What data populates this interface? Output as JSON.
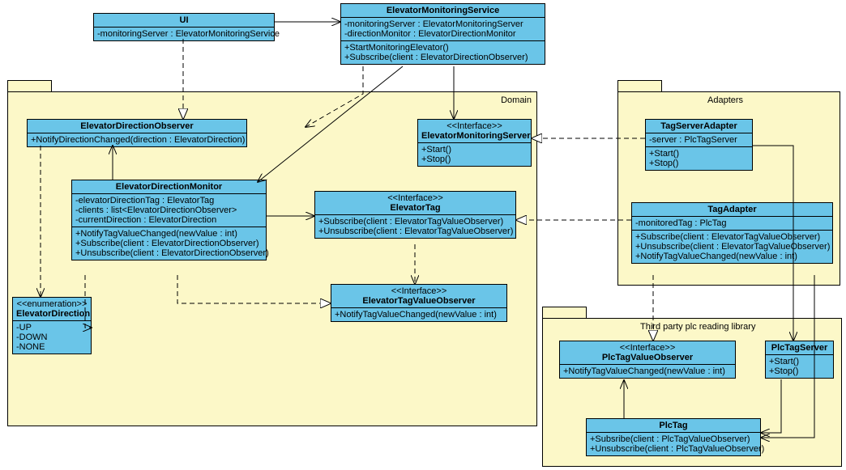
{
  "packages": {
    "domain": {
      "label": "Domain"
    },
    "adapters": {
      "label": "Adapters"
    },
    "thirdparty": {
      "label": "Third party plc reading library"
    }
  },
  "classes": {
    "ui": {
      "name": "UI",
      "attrs": [
        "-monitoringServer : ElevatorMonitoringService"
      ]
    },
    "ems": {
      "name": "ElevatorMonitoringService",
      "attrs": [
        "-monitoringServer : ElevatorMonitoringServer",
        "-directionMonitor : ElevatorDirectionMonitor"
      ],
      "ops": [
        "+StartMonitoringElevator()",
        "+Subscribe(client : ElevatorDirectionObserver)"
      ]
    },
    "edo": {
      "name": "ElevatorDirectionObserver",
      "ops": [
        "+NotifyDirectionChanged(direction : ElevatorDirection)"
      ]
    },
    "edm": {
      "name": "ElevatorDirectionMonitor",
      "attrs": [
        "-elevatorDirectionTag : ElevatorTag",
        "-clients : list<ElevatorDirectionObserver>",
        "-currentDirection : ElevatorDirection"
      ],
      "ops": [
        "+NotifyTagValueChanged(newValue : int)",
        "+Subscribe(client : ElevatorDirectionObserver)",
        "+Unsubscribe(client : ElevatorDirectionObserver)"
      ]
    },
    "emserver": {
      "stereo": "<<Interface>>",
      "name": "ElevatorMonitoringServer",
      "ops": [
        "+Start()",
        "+Stop()"
      ]
    },
    "etag": {
      "stereo": "<<Interface>>",
      "name": "ElevatorTag",
      "ops": [
        "+Subscribe(client : ElevatorTagValueObserver)",
        "+Unsubscribe(client : ElevatorTagValueObserver)"
      ]
    },
    "etvo": {
      "stereo": "<<Interface>>",
      "name": "ElevatorTagValueObserver",
      "ops": [
        "+NotifyTagValueChanged(newValue : int)"
      ]
    },
    "edir": {
      "stereo": "<<enumeration>>",
      "name": "ElevatorDirection",
      "attrs": [
        "-UP",
        "-DOWN",
        "-NONE"
      ]
    },
    "tsa": {
      "name": "TagServerAdapter",
      "attrs": [
        "-server : PlcTagServer"
      ],
      "ops": [
        "+Start()",
        "+Stop()"
      ]
    },
    "ta": {
      "name": "TagAdapter",
      "attrs": [
        "-monitoredTag : PlcTag"
      ],
      "ops": [
        "+Subscribe(client : ElevatorTagValueObserver)",
        "+Unsubscribe(client : ElevatorTagValueObserver)",
        "+NotifyTagValueChanged(newValue : int)"
      ]
    },
    "ptvo": {
      "stereo": "<<Interface>>",
      "name": "PlcTagValueObserver",
      "ops": [
        "+NotifyTagValueChanged(newValue : int)"
      ]
    },
    "pts": {
      "name": "PlcTagServer",
      "ops": [
        "+Start()",
        "+Stop()"
      ]
    },
    "ptag": {
      "name": "PlcTag",
      "ops": [
        "+Subsribe(client : PlcTagValueObserver)",
        "+Unsubscribe(client : PlcTagValueObserver)"
      ]
    }
  }
}
